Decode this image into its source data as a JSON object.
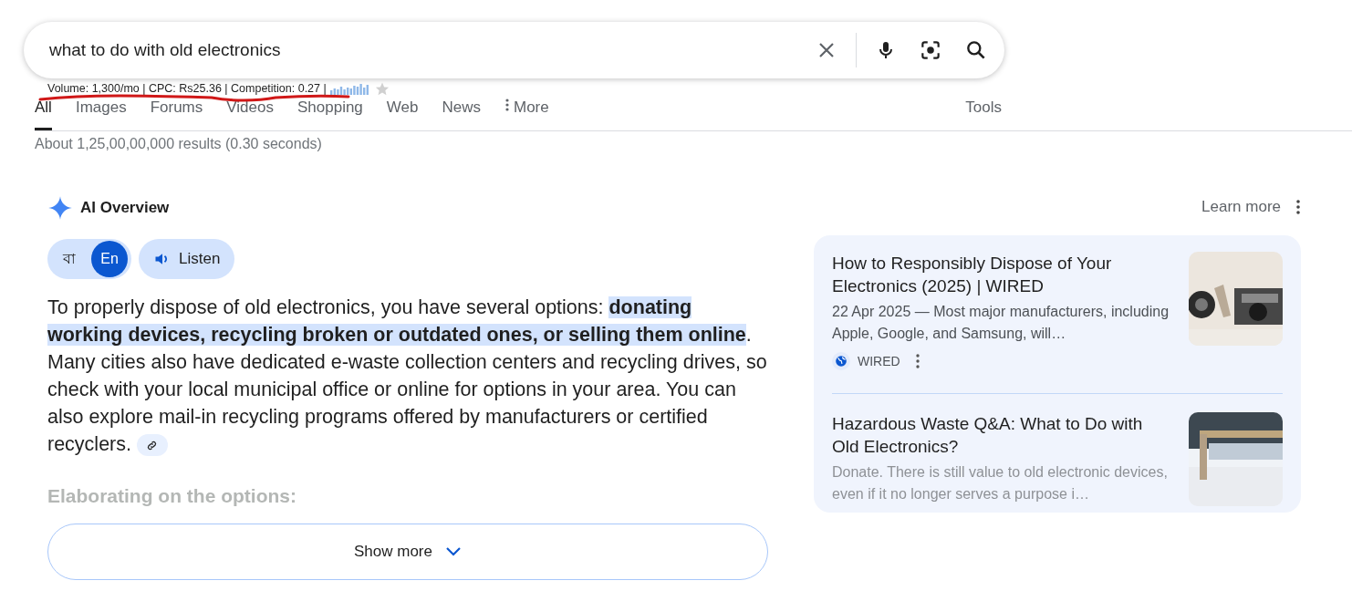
{
  "search": {
    "value": "what to do with old electronics"
  },
  "seo_bar": {
    "text": "Volume: 1,300/mo | CPC: Rs25.36 | Competition: 0.27 |"
  },
  "tabs": [
    {
      "label": "All",
      "selected": true
    },
    {
      "label": "Images",
      "selected": false
    },
    {
      "label": "Forums",
      "selected": false
    },
    {
      "label": "Videos",
      "selected": false
    },
    {
      "label": "Shopping",
      "selected": false
    },
    {
      "label": "Web",
      "selected": false
    },
    {
      "label": "News",
      "selected": false
    },
    {
      "label": "More",
      "selected": false,
      "kind": "menu"
    }
  ],
  "tools": "Tools",
  "result_stats": "About 1,25,00,00,000 results (0.30 seconds)",
  "ai_overview": {
    "title": "AI Overview",
    "learn_more": "Learn more",
    "languages": [
      {
        "label": "বা",
        "selected": false
      },
      {
        "label": "En",
        "selected": true
      }
    ],
    "listen": "Listen",
    "paragraph": [
      {
        "text": "To properly dispose of old electronics, you have several options: ",
        "highlighted": false
      },
      {
        "text": "donating working devices, recycling broken or outdated ones, or selling them online",
        "highlighted": true
      },
      {
        "text": ". Many cities also have dedicated e-waste collection centers and recycling drives, so check with your local municipal office or online for options in your area. You can also explore mail-in recycling programs offered by manufacturers or certified recyclers.",
        "highlighted": false
      }
    ],
    "subheading": "Elaborating on the options:",
    "show_more": "Show more",
    "sources": [
      {
        "title": "How to Responsibly Dispose of Your Electronics (2025) | WIRED",
        "snippet": "22 Apr 2025 — Most major manufacturers, including Apple, Google, and Samsung, will…",
        "site": "WIRED",
        "faded": false
      },
      {
        "title": "Hazardous Waste Q&A: What to Do with Old Electronics?",
        "snippet": "Donate. There is still value to old electronic devices, even if it no longer serves a purpose i…",
        "faded": true
      }
    ]
  }
}
